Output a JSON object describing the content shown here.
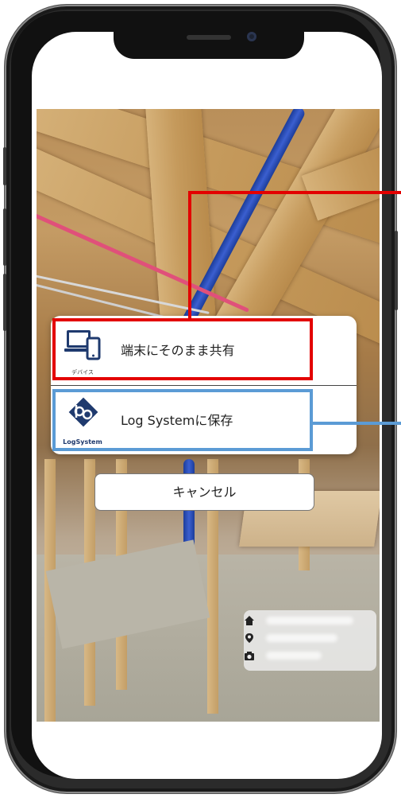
{
  "share_sheet": {
    "options": [
      {
        "label": "端末にそのまま共有",
        "icon": "device-icon",
        "icon_caption": "デバイス"
      },
      {
        "label": "Log Systemに保存",
        "icon": "log-system-icon",
        "icon_caption": "LogSystem"
      }
    ]
  },
  "cancel_label": "キャンセル",
  "info_card": {
    "icons": [
      "home-icon",
      "location-pin-icon",
      "camera-icon"
    ]
  },
  "colors": {
    "highlight_red": "#e30000",
    "highlight_blue": "#5b9bd5"
  }
}
